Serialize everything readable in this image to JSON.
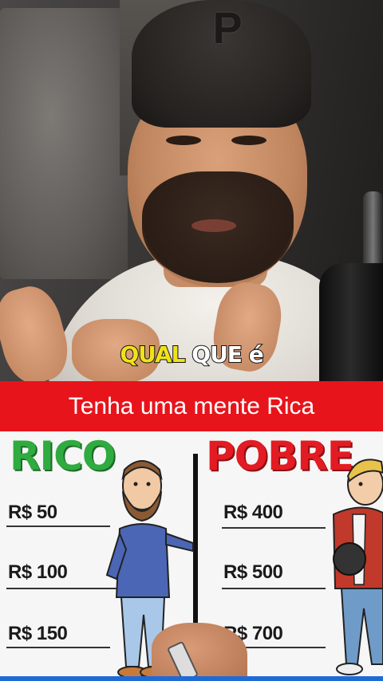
{
  "video": {
    "caption_word_1": "QUAL",
    "caption_word_2": "QUE",
    "caption_word_3": "é"
  },
  "banner": {
    "text": "Tenha uma mente Rica",
    "color": "#e8141b"
  },
  "board": {
    "left_heading": "RICO",
    "right_heading": "POBRE",
    "left_color": "#2fab3f",
    "right_color": "#e31b22",
    "left_amounts": [
      "R$ 50",
      "R$ 100",
      "R$ 150"
    ],
    "right_amounts": [
      "R$ 400",
      "R$ 500",
      "R$ 700"
    ]
  }
}
